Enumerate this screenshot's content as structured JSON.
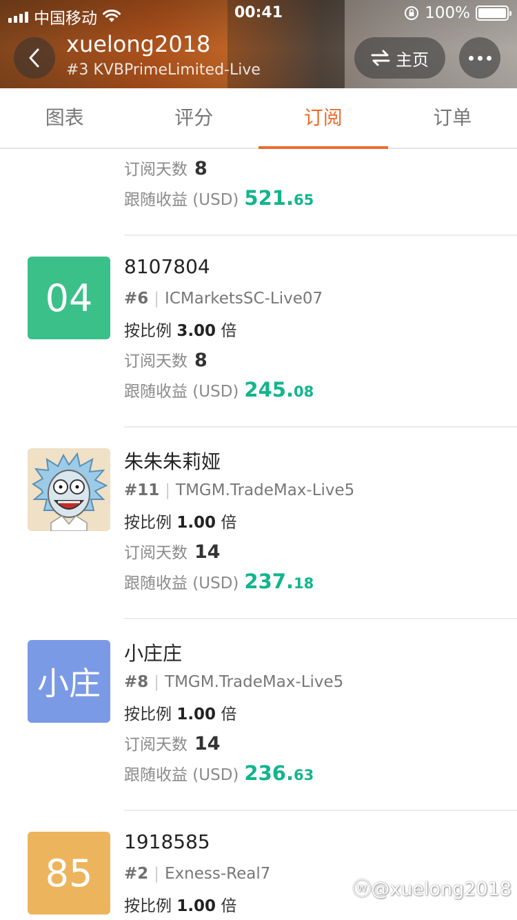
{
  "statusbar": {
    "carrier": "中国移动",
    "time": "00:41",
    "battery": "100%"
  },
  "header": {
    "username": "xuelong2018",
    "server": "#3 KVBPrimeLimited-Live",
    "home_label": "主页",
    "home_icon": "swap-arrows-icon",
    "more_icon": "ellipsis-icon"
  },
  "tabs": [
    {
      "label": "图表",
      "active": false
    },
    {
      "label": "评分",
      "active": false
    },
    {
      "label": "订阅",
      "active": true
    },
    {
      "label": "订单",
      "active": false
    }
  ],
  "labels": {
    "ratio_prefix": "按比例",
    "ratio_suffix": "倍",
    "days": "订阅天数",
    "profit": "跟随收益 (USD)"
  },
  "partial_card": {
    "days": "8",
    "profit_int": "521.",
    "profit_dec": "65"
  },
  "cards": [
    {
      "avatar_text": "04",
      "avatar_color": "#3cc08a",
      "name": "8107804",
      "rank": "#6",
      "server": "ICMarketsSC-Live07",
      "ratio": "3.00",
      "days": "8",
      "profit_int": "245.",
      "profit_dec": "08"
    },
    {
      "avatar_text": "",
      "avatar_image": "cartoon-character-avatar",
      "avatar_color": "#efe0c6",
      "name": "朱朱朱莉娅",
      "rank": "#11",
      "server": "TMGM.TradeMax-Live5",
      "ratio": "1.00",
      "days": "14",
      "profit_int": "237.",
      "profit_dec": "18"
    },
    {
      "avatar_text": "小庄",
      "avatar_color": "#7b9ae6",
      "name": "小庄庄",
      "rank": "#8",
      "server": "TMGM.TradeMax-Live5",
      "ratio": "1.00",
      "days": "14",
      "profit_int": "236.",
      "profit_dec": "63"
    },
    {
      "avatar_text": "85",
      "avatar_color": "#edb45e",
      "name": "1918585",
      "rank": "#2",
      "server": "Exness-Real7",
      "ratio": "1.00"
    }
  ],
  "watermark": "@xuelong2018"
}
